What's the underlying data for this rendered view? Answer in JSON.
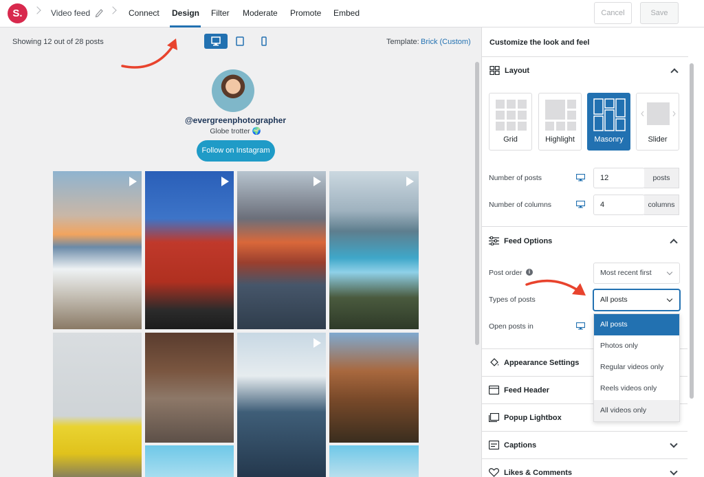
{
  "app": {
    "logo_letter": "S."
  },
  "topbar": {
    "feed_name": "Video feed",
    "tabs": [
      {
        "label": "Connect"
      },
      {
        "label": "Design"
      },
      {
        "label": "Filter"
      },
      {
        "label": "Moderate"
      },
      {
        "label": "Promote"
      },
      {
        "label": "Embed"
      }
    ],
    "active_tab": "Design",
    "cancel_label": "Cancel",
    "save_label": "Save"
  },
  "preview": {
    "showing_text": "Showing 12 out of 28 posts",
    "devices": [
      "desktop-icon",
      "tablet-icon",
      "phone-icon"
    ],
    "active_device": "desktop",
    "template_label": "Template:",
    "template_value": "Brick (Custom)",
    "profile": {
      "username": "@evergreenphotographer",
      "bio": "Globe trotter 🌍",
      "follow_label": "Follow on Instagram"
    }
  },
  "panel": {
    "title": "Customize the look and feel",
    "layout": {
      "label": "Layout",
      "options": [
        {
          "label": "Grid"
        },
        {
          "label": "Highlight"
        },
        {
          "label": "Masonry"
        },
        {
          "label": "Slider"
        }
      ],
      "selected": "Masonry",
      "num_posts_label": "Number of posts",
      "num_posts_value": "12",
      "num_posts_unit": "posts",
      "num_cols_label": "Number of columns",
      "num_cols_value": "4",
      "num_cols_unit": "columns"
    },
    "feed_options": {
      "label": "Feed Options",
      "post_order_label": "Post order",
      "post_order_value": "Most recent first",
      "types_label": "Types of posts",
      "types_value": "All posts",
      "open_posts_label": "Open posts in",
      "dropdown_options": [
        {
          "label": "All posts"
        },
        {
          "label": "Photos only"
        },
        {
          "label": "Regular videos only"
        },
        {
          "label": "Reels videos only"
        },
        {
          "label": "All videos only"
        }
      ]
    },
    "sections": [
      {
        "label": "Appearance Settings"
      },
      {
        "label": "Feed Header"
      },
      {
        "label": "Popup Lightbox"
      },
      {
        "label": "Captions"
      },
      {
        "label": "Likes & Comments"
      }
    ]
  },
  "colors": {
    "accent": "#2271b1",
    "logo": "#d8294d",
    "follow": "#1f9bc7",
    "annotation_arrow": "#e8432d"
  }
}
